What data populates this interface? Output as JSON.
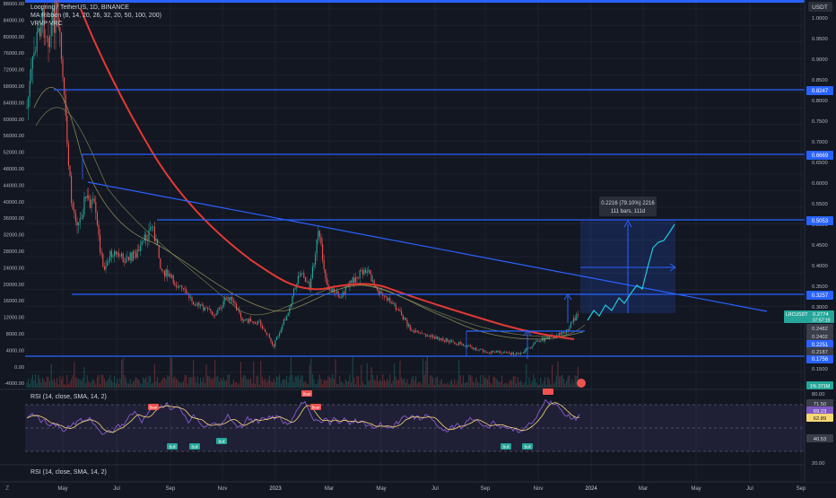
{
  "header": {
    "symbol_line": "Loopring / TetherUS, 1D, BINANCE",
    "indicator_ma": "MA Ribbon (8, 14, 20, 26, 32, 20, 50, 100, 200)",
    "indicator_vrvp": "VRVP VRC"
  },
  "left_axis": {
    "labels": [
      "88000.00",
      "84000.00",
      "80000.00",
      "76000.00",
      "72000.00",
      "68000.00",
      "64000.00",
      "60000.00",
      "56000.00",
      "52000.00",
      "48000.00",
      "44000.00",
      "40000.00",
      "36000.00",
      "32000.00",
      "28000.00",
      "24000.00",
      "20000.00",
      "16000.00",
      "12000.00",
      "8000.00",
      "4000.00",
      "0.00",
      "-4000.00"
    ]
  },
  "right_axis": {
    "currency": "USDT",
    "labels": [
      "1.0000",
      "0.9500",
      "0.9000",
      "0.8500",
      "0.8000",
      "0.7500",
      "0.7000",
      "0.6500",
      "0.6000",
      "0.5500",
      "0.5000",
      "0.4500",
      "0.4000",
      "0.3500",
      "0.3000",
      "0.2500",
      "0.2000",
      "0.1500"
    ],
    "level_badges": [
      {
        "text": "0.8247",
        "color": "#2962ff"
      },
      {
        "text": "0.6669",
        "color": "#2962ff"
      },
      {
        "text": "0.5053",
        "color": "#2962ff"
      },
      {
        "text": "0.3257",
        "color": "#2962ff"
      },
      {
        "text": "0.2251",
        "color": "#2962ff"
      },
      {
        "text": "0.1756",
        "color": "#2962ff"
      }
    ],
    "price_badge": {
      "symbol": "LRCUSDT",
      "price": "0.2774",
      "countdown": "07:57:19"
    },
    "ma_badges": [
      "0.2482",
      "0.2402",
      "0.2187"
    ],
    "volume_badge": "1% 371M"
  },
  "measure_box": {
    "line1": "0.2216 (79.10%) 2216",
    "line2": "111 bars, 111d"
  },
  "rsi_panel": {
    "title": "RSI (14, close, SMA, 14, 2)",
    "labels": [
      "80.00",
      "20.00"
    ],
    "value_badges": [
      "71.50",
      "69.23",
      "62.89",
      "40.53"
    ],
    "divergence_labels": [
      "Bear",
      "Bear",
      "Bear",
      "Bull",
      "Bull",
      "Bull",
      "Bull",
      "Bull"
    ]
  },
  "rsi_panel2": {
    "title": "RSI (14, close, SMA, 14, 2)"
  },
  "time_axis": {
    "labels": [
      "May",
      "Jul",
      "Sep",
      "Nov",
      "2023",
      "Mar",
      "May",
      "Jul",
      "Sep",
      "Nov",
      "2024",
      "Mar",
      "May",
      "Jul",
      "Sep"
    ]
  },
  "colors": {
    "background": "#131722",
    "level_line": "#2962ff",
    "ma200": "#e53935",
    "projection": "#26c6da",
    "up_candle": "#26a69a",
    "down_candle": "#ef5350"
  }
}
